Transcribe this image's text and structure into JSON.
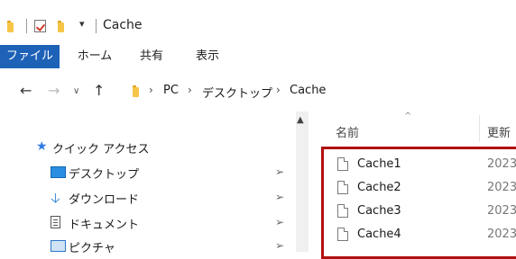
{
  "window": {
    "title": "Cache",
    "quick_access_dropdown": "▾"
  },
  "ribbon": {
    "tabs": [
      {
        "label": "ファイル",
        "active": true
      },
      {
        "label": "ホーム"
      },
      {
        "label": "共有"
      },
      {
        "label": "表示"
      }
    ]
  },
  "nav": {
    "back": "←",
    "forward": "→",
    "recent": "∨",
    "up": "↑",
    "breadcrumb": [
      "PC",
      "デスクトップ",
      "Cache"
    ],
    "separator": "›"
  },
  "navpane": {
    "scroll_up": "▲",
    "quick_access": {
      "label": "クイック アクセス",
      "icon": "star-icon"
    },
    "items": [
      {
        "label": "デスクトップ",
        "icon": "desktop-icon",
        "pinned": true
      },
      {
        "label": "ダウンロード",
        "icon": "download-icon",
        "pinned": true
      },
      {
        "label": "ドキュメント",
        "icon": "document-icon",
        "pinned": true
      },
      {
        "label": "ピクチャ",
        "icon": "pictures-icon",
        "pinned": true
      }
    ],
    "pin_glyph": "📌"
  },
  "filepane": {
    "sort_indicator": "^",
    "columns": {
      "name": "名前",
      "date": "更新"
    },
    "files": [
      {
        "name": "Cache1",
        "date": "2023"
      },
      {
        "name": "Cache2",
        "date": "2023"
      },
      {
        "name": "Cache3",
        "date": "2023"
      },
      {
        "name": "Cache4",
        "date": "2023"
      }
    ],
    "highlight_color": "#b01010"
  },
  "colors": {
    "file_tab_bg": "#1e62b8",
    "folder": "#f6c547",
    "star": "#2f7ce5"
  }
}
